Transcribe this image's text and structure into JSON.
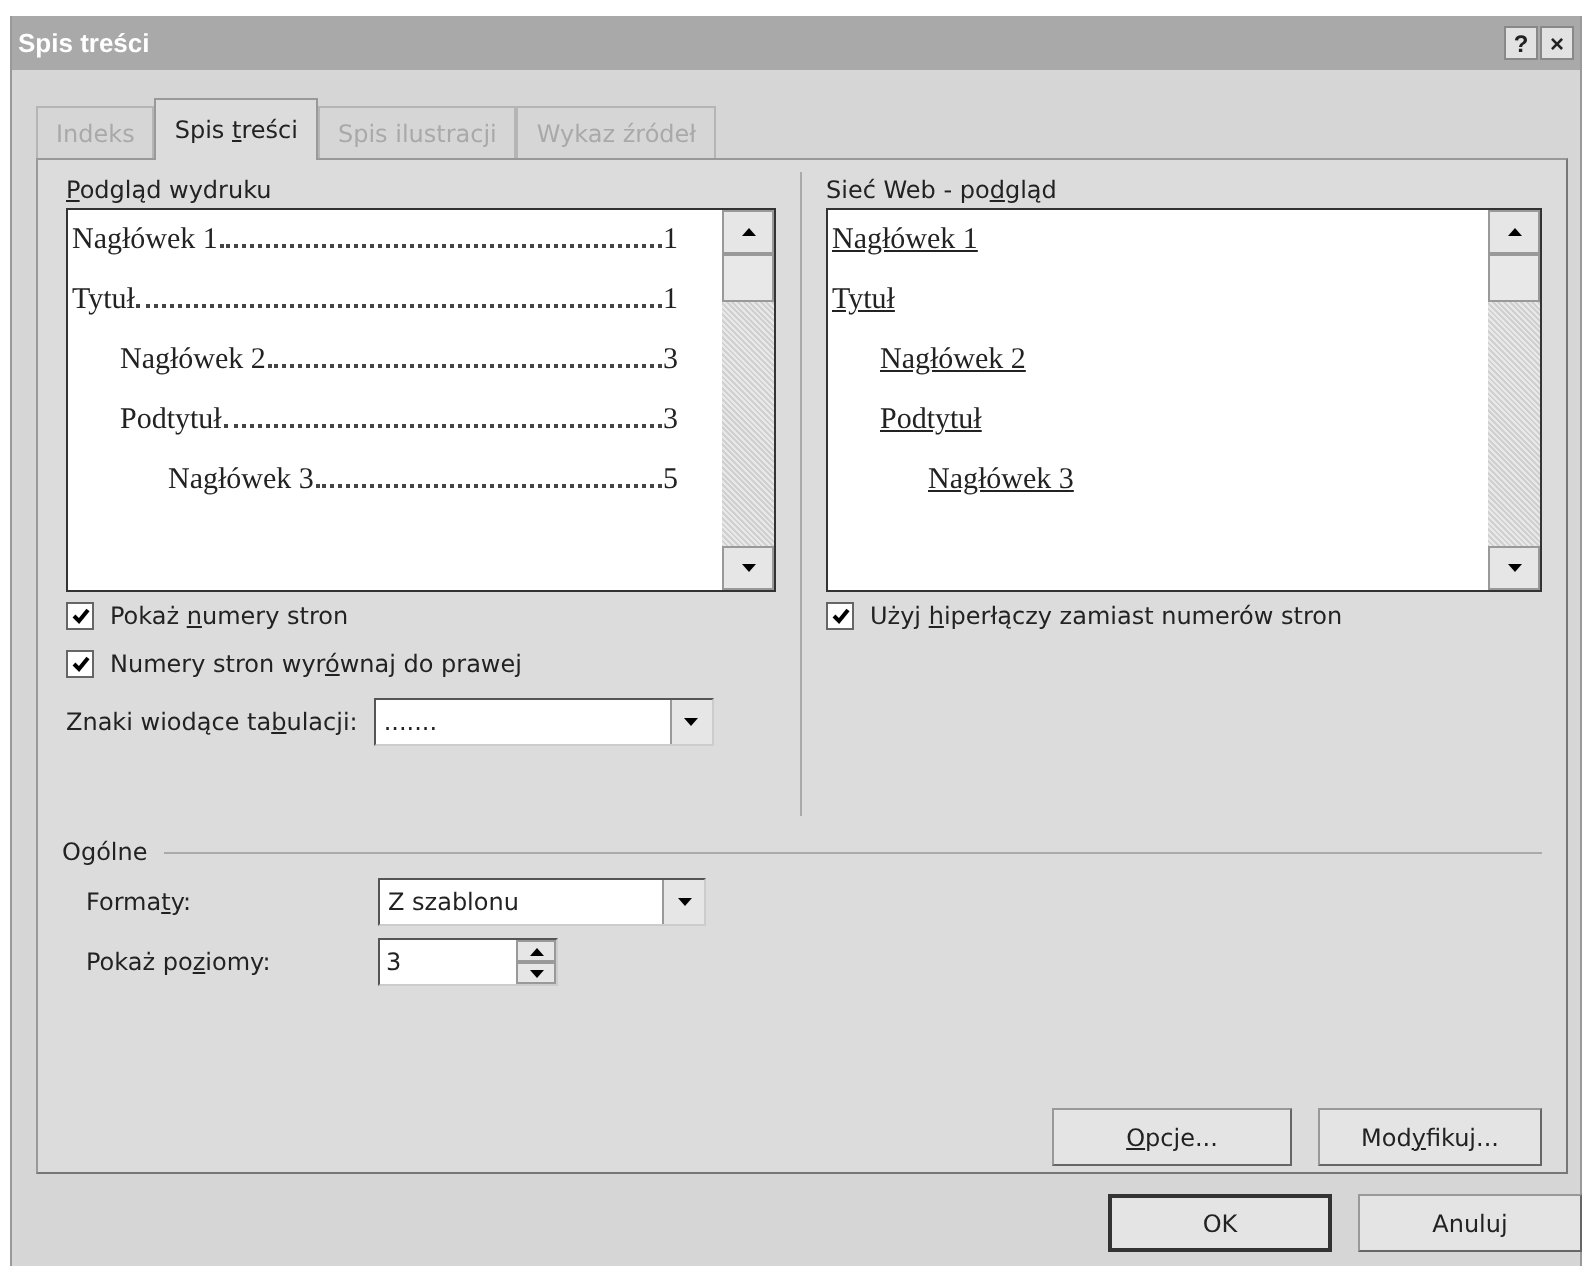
{
  "window": {
    "title": "Spis treści",
    "help": "?",
    "close": "×"
  },
  "tabs": [
    {
      "label": "Indeks",
      "selected": false,
      "disabled": true
    },
    {
      "label": {
        "before": "Spis ",
        "key": "t",
        "after": "reści"
      },
      "selected": true,
      "disabled": false
    },
    {
      "label": "Spis ilustracji",
      "selected": false,
      "disabled": true
    },
    {
      "label": "Wykaz źródeł",
      "selected": false,
      "disabled": true
    }
  ],
  "print_preview": {
    "label": {
      "key": "P",
      "after": "odgląd wydruku"
    },
    "entries": [
      {
        "text": "Nagłówek 1",
        "page": "1"
      },
      {
        "text": "Tytuł",
        "page": "1",
        "children": [
          {
            "text": "Nagłówek 2",
            "page": "3"
          },
          {
            "text": "Podtytuł",
            "page": "3",
            "children": [
              {
                "text": "Nagłówek 3",
                "page": "5"
              }
            ]
          }
        ]
      }
    ]
  },
  "web_preview": {
    "label": {
      "before": "Sieć Web - po",
      "key": "d",
      "after": "gląd"
    },
    "entries": [
      {
        "text": "Nagłówek 1"
      },
      {
        "text": "Tytuł",
        "children": [
          {
            "text": "Nagłówek 2"
          },
          {
            "text": "Podtytuł",
            "children": [
              {
                "text": "Nagłówek 3"
              }
            ]
          }
        ]
      }
    ]
  },
  "left_options": [
    {
      "label": {
        "before": "Pokaż ",
        "key": "n",
        "after": "umery stron"
      },
      "checked": true
    },
    {
      "label": {
        "before": "Numery stron wyr",
        "key": "ó",
        "after": "wnaj do prawej"
      },
      "checked": true
    }
  ],
  "tab_leader": {
    "label": {
      "before": "Znaki wiodące ta",
      "key": "b",
      "after": "ulacji:"
    },
    "value": "......."
  },
  "right_options": [
    {
      "label": {
        "before": "Użyj ",
        "key": "h",
        "after": "iperłączy zamiast numerów stron"
      },
      "checked": true
    }
  ],
  "general": {
    "title": "Ogólne",
    "formats": {
      "label": {
        "before": "Forma",
        "key": "t",
        "after": "y:"
      },
      "value": "Z szablonu"
    },
    "levels": {
      "label": {
        "before": "Pokaż po",
        "key": "z",
        "after": "iomy:"
      },
      "value": "3"
    }
  },
  "panel_buttons": [
    {
      "label": {
        "key": "O",
        "after": "pcje..."
      }
    },
    {
      "label": {
        "before": "Mod",
        "key": "y",
        "after": "fikuj..."
      }
    }
  ],
  "buttons": [
    {
      "label": "OK",
      "default": true
    },
    {
      "label": "Anuluj",
      "default": false
    }
  ]
}
